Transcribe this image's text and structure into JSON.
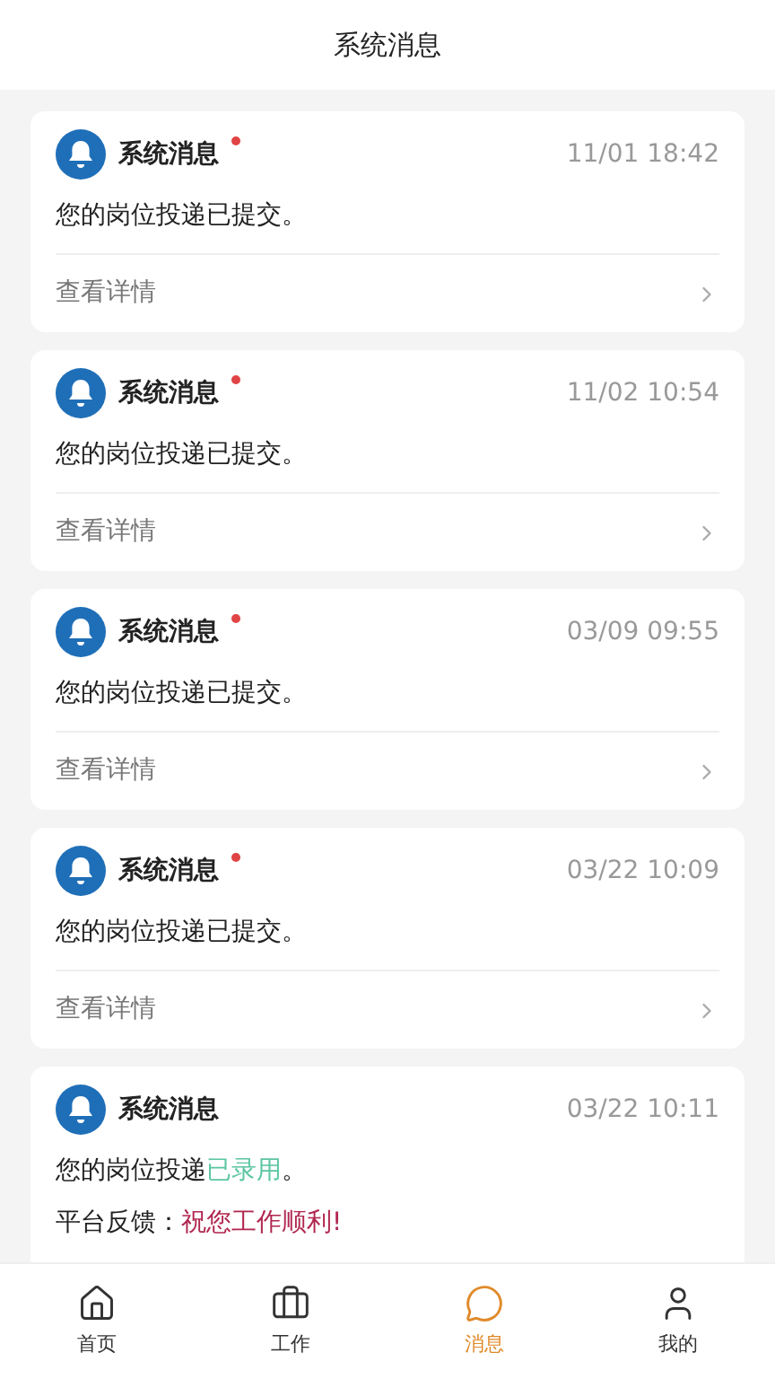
{
  "header": {
    "title": "系统消息"
  },
  "messages": [
    {
      "title": "系统消息",
      "unread": true,
      "time": "11/01 18:42",
      "body": [
        {
          "text": "您的岗位投递已提交。",
          "kind": "plain"
        }
      ],
      "link": "查看详情"
    },
    {
      "title": "系统消息",
      "unread": true,
      "time": "11/02 10:54",
      "body": [
        {
          "text": "您的岗位投递已提交。",
          "kind": "plain"
        }
      ],
      "link": "查看详情"
    },
    {
      "title": "系统消息",
      "unread": true,
      "time": "03/09 09:55",
      "body": [
        {
          "text": "您的岗位投递已提交。",
          "kind": "plain"
        }
      ],
      "link": "查看详情"
    },
    {
      "title": "系统消息",
      "unread": true,
      "time": "03/22 10:09",
      "body": [
        {
          "text": "您的岗位投递已提交。",
          "kind": "plain"
        }
      ],
      "link": "查看详情"
    },
    {
      "title": "系统消息",
      "unread": false,
      "time": "03/22 10:11",
      "body": [
        {
          "text": "您的岗位投递",
          "kind": "plain"
        },
        {
          "text": "已录用",
          "kind": "success"
        },
        {
          "text": "。",
          "kind": "plain"
        }
      ],
      "feedback": {
        "label": "平台反馈：",
        "value": "祝您工作顺利!"
      }
    }
  ],
  "tabs": [
    {
      "label": "首页",
      "kind": "home",
      "selected": false
    },
    {
      "label": "工作",
      "kind": "work",
      "selected": false
    },
    {
      "label": "消息",
      "kind": "chat",
      "selected": true
    },
    {
      "label": "我的",
      "kind": "user",
      "selected": false
    }
  ]
}
